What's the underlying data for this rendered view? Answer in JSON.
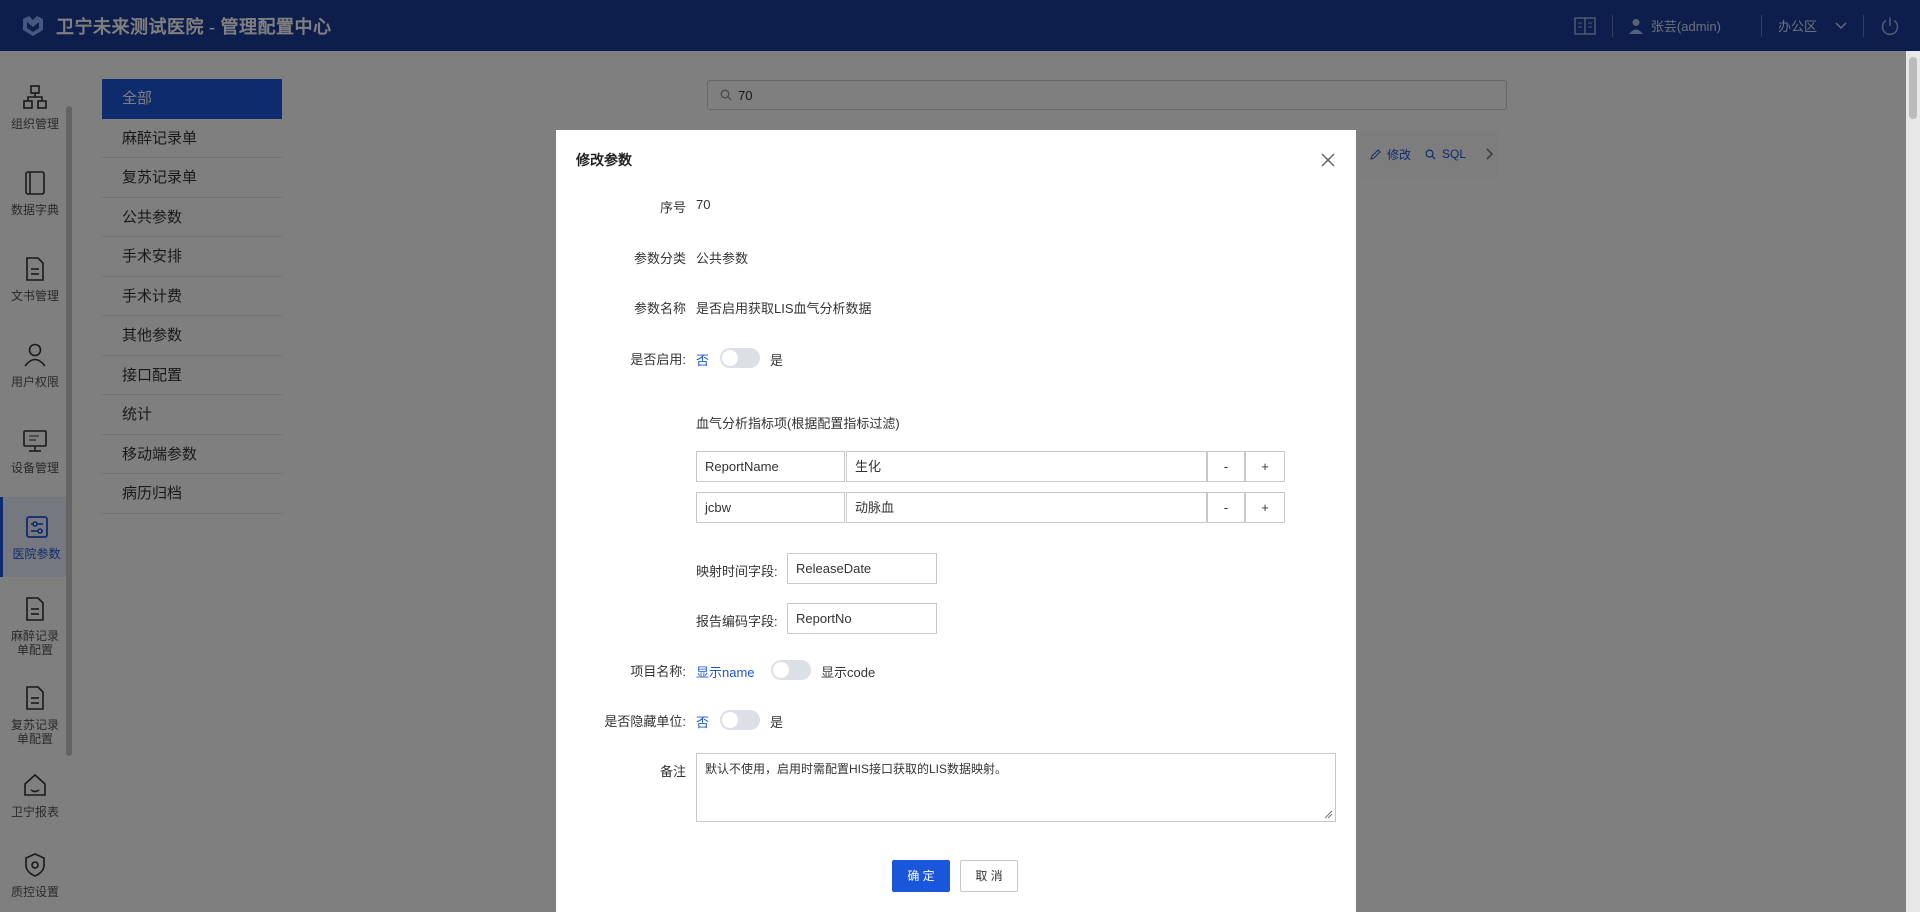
{
  "header": {
    "title": "卫宁未来测试医院 - 管理配置中心",
    "user_name": "张芸(admin)",
    "workspace": "办公区"
  },
  "left_nav": {
    "items": [
      {
        "label": "组织管理",
        "icon": "org-icon"
      },
      {
        "label": "数据字典",
        "icon": "book-icon"
      },
      {
        "label": "文书管理",
        "icon": "document-icon"
      },
      {
        "label": "用户权限",
        "icon": "user-icon"
      },
      {
        "label": "设备管理",
        "icon": "monitor-icon"
      },
      {
        "label": "医院参数",
        "icon": "settings-panel-icon",
        "active": true
      },
      {
        "label": "麻醉记录单配置",
        "icon": "document-icon"
      },
      {
        "label": "复苏记录单配置",
        "icon": "document-icon"
      },
      {
        "label": "卫宁报表",
        "icon": "home-icon"
      },
      {
        "label": "质控设置",
        "icon": "shield-icon"
      }
    ]
  },
  "categories": {
    "items": [
      "全部",
      "麻醉记录单",
      "复苏记录单",
      "公共参数",
      "手术安排",
      "手术计费",
      "其他参数",
      "接口配置",
      "统计",
      "移动端参数",
      "病历归档"
    ],
    "active": "全部"
  },
  "search": {
    "value": "70"
  },
  "row_actions": {
    "edit": "修改",
    "sql": "SQL"
  },
  "dialog": {
    "title": "修改参数",
    "fields": {
      "seq_label": "序号",
      "seq_value": "70",
      "category_label": "参数分类",
      "category_value": "公共参数",
      "name_label": "参数名称",
      "name_value": "是否启用获取LIS血气分析数据",
      "enable_label": "是否启用:",
      "enable_off": "否",
      "enable_on": "是",
      "indicator_title": "血气分析指标项(根据配置指标过滤)",
      "indicator_rows": [
        {
          "key": "ReportName",
          "value": "生化"
        },
        {
          "key": "jcbw",
          "value": "动脉血"
        }
      ],
      "minus_label": "-",
      "plus_label": "+",
      "time_field_label": "映射时间字段:",
      "time_field_value": "ReleaseDate",
      "code_field_label": "报告编码字段:",
      "code_field_value": "ReportNo",
      "item_name_label": "项目名称:",
      "item_name_off": "显示name",
      "item_name_on": "显示code",
      "hide_unit_label": "是否隐藏单位:",
      "hide_unit_off": "否",
      "hide_unit_on": "是",
      "remark_label": "备注",
      "remark_value": "默认不使用，启用时需配置HIS接口获取的LIS数据映射。"
    },
    "ok_label": "确 定",
    "cancel_label": "取 消"
  }
}
